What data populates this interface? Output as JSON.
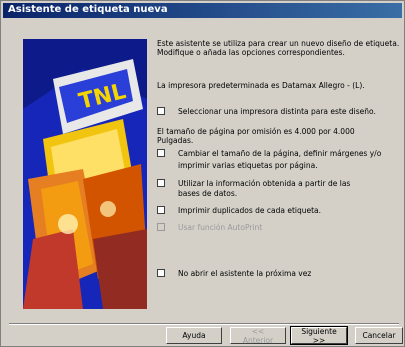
{
  "window": {
    "title": "Asistente de etiqueta nueva"
  },
  "banner": {
    "icon": "labeler-printer-illustration"
  },
  "intro": {
    "line1": "Este asistente se utiliza para crear un nuevo diseño de etiqueta.",
    "line2": "Modifique o añada las opciones correspondientes."
  },
  "printer": {
    "default_text": "La impresora predeterminada es Datamax Allegro - (L)."
  },
  "options": {
    "select_printer": "Seleccionar una impresora distinta para este diseño.",
    "page_size_line1": "El tamaño de página por omisión es 4.000 por 4.000",
    "page_size_line2": "Pulgadas.",
    "change_size_line1": "Cambiar el tamaño de la página, definir márgenes y/o",
    "change_size_line2": "imprimir varias etiquetas por página.",
    "database_line1": "Utilizar la información obtenida a partir de las",
    "database_line2": "bases de datos.",
    "duplicates": "Imprimir duplicados de cada etiqueta.",
    "autoprint": "Usar función AutoPrint",
    "dont_open": "No abrir el asistente la próxima vez"
  },
  "buttons": {
    "help": "Ayuda",
    "back": "<< Anterior",
    "next": "Siguiente >>",
    "cancel": "Cancelar"
  },
  "colors": {
    "titlebar": "#0a246a",
    "banner": "#1a2cc9",
    "face": "#d4d0c8"
  }
}
